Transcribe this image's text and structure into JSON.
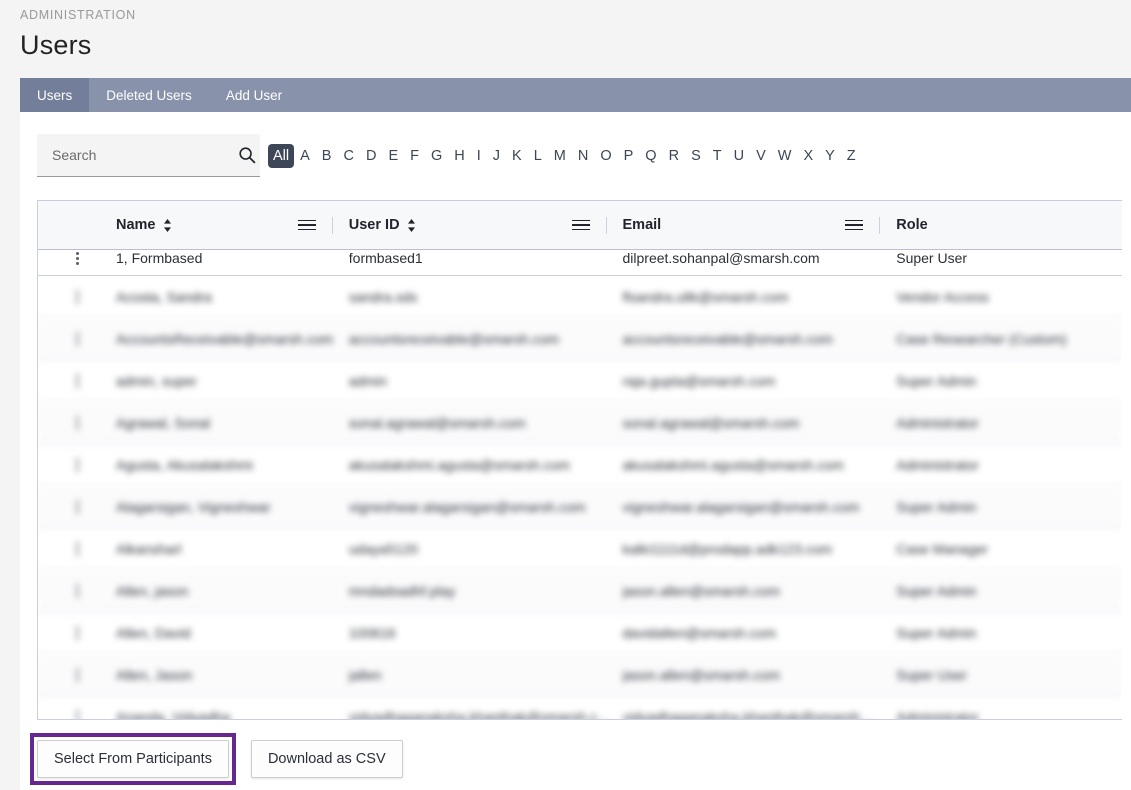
{
  "breadcrumb": "ADMINISTRATION",
  "page_title": "Users",
  "tabs": [
    {
      "label": "Users",
      "active": true
    },
    {
      "label": "Deleted Users",
      "active": false
    },
    {
      "label": "Add User",
      "active": false
    }
  ],
  "search": {
    "placeholder": "Search",
    "value": "",
    "icon": "search-icon"
  },
  "alphabet_filter": {
    "selected": "All",
    "items": [
      "All",
      "A",
      "B",
      "C",
      "D",
      "E",
      "F",
      "G",
      "H",
      "I",
      "J",
      "K",
      "L",
      "M",
      "N",
      "O",
      "P",
      "Q",
      "R",
      "S",
      "T",
      "U",
      "V",
      "W",
      "X",
      "Y",
      "Z"
    ]
  },
  "table": {
    "columns": [
      {
        "label": "Name",
        "sortable": true,
        "menu_icon": "hamburger-menu-icon"
      },
      {
        "label": "User ID",
        "sortable": true,
        "menu_icon": "hamburger-menu-icon"
      },
      {
        "label": "Email",
        "sortable": false,
        "menu_icon": "hamburger-menu-icon"
      },
      {
        "label": "Role",
        "sortable": false,
        "menu_icon": null
      }
    ],
    "rows": [
      {
        "name": "1, Formbased",
        "user_id": "formbased1",
        "email": "dilpreet.sohanpal@smarsh.com",
        "role": "Super User",
        "redacted": false
      },
      {
        "name": "Acosta, Sandra",
        "user_id": "sandra.sds",
        "email": "flsandra.ultk@smarsh.com",
        "role": "Vendor Access",
        "redacted": true
      },
      {
        "name": "AccountsReceivable@smarsh.com",
        "user_id": "accountsreceivable@smarsh.com",
        "email": "accountsreceivable@smarsh.com",
        "role": "Case Researcher (Custom)",
        "redacted": true
      },
      {
        "name": "admin, super",
        "user_id": "admin",
        "email": "raja.gupta@smarsh.com",
        "role": "Super Admin",
        "redacted": true
      },
      {
        "name": "Agrawal, Sonal",
        "user_id": "sonal.agrawal@smarsh.com",
        "email": "sonal.agrawal@smarsh.com",
        "role": "Administrator",
        "redacted": true
      },
      {
        "name": "Agusta, Akusalakshmi",
        "user_id": "akusalakshmi.agusta@smarsh.com",
        "email": "akusalakshmi.agusta@smarsh.com",
        "role": "Administrator",
        "redacted": true
      },
      {
        "name": "Alagarsigan, Vigneshwar",
        "user_id": "vigneshwar.alagarsigan@smarsh.com",
        "email": "vigneshwar.alagarsigan@smarsh.com",
        "role": "Super Admin",
        "redacted": true
      },
      {
        "name": "Alkansharl",
        "user_id": "udaya5120",
        "email": "kalki1111d@prodapp.adk123.com",
        "role": "Case Manager",
        "redacted": true
      },
      {
        "name": "Allen, jason",
        "user_id": "mndadsadhf.play",
        "email": "jason.allen@smarsh.com",
        "role": "Super Admin",
        "redacted": true
      },
      {
        "name": "Allen, David",
        "user_id": "100616",
        "email": "davidallen@smarsh.com",
        "role": "Super Admin",
        "redacted": true
      },
      {
        "name": "Allen, Jason",
        "user_id": "jallen",
        "email": "jason.allen@smarsh.com",
        "role": "Super User",
        "redacted": true
      },
      {
        "name": "Ananda, Vidyadha",
        "user_id": "vidyadhaganaksha.khanthak@smarsh.c...",
        "email": "vidyadhaganaksha.khanthak@smarsh...",
        "role": "Administrator",
        "redacted": true
      }
    ]
  },
  "footer_buttons": [
    {
      "label": "Select From Participants",
      "highlighted": true
    },
    {
      "label": "Download as CSV",
      "highlighted": false
    }
  ],
  "colors": {
    "highlight": "#66288f",
    "tabbar": "#8892ab",
    "tab_active": "#737e9a",
    "alpha_active": "#3d4758"
  }
}
